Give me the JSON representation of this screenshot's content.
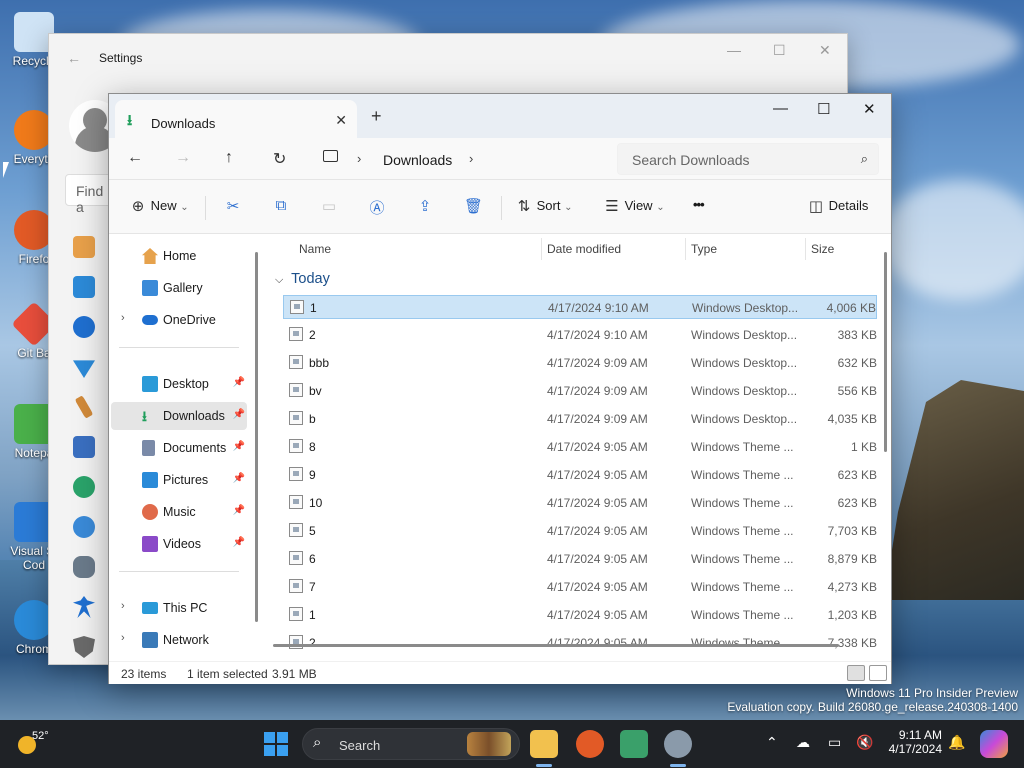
{
  "desktop": {
    "icons": [
      {
        "label": "Recycle",
        "color": "#cfe3f5"
      },
      {
        "label": "Everyth",
        "color": "#f07a1a"
      },
      {
        "label": "Firefo",
        "color": "#e25a26"
      },
      {
        "label": "Git Ba",
        "color": "#e84e3c"
      },
      {
        "label": "Notepa",
        "color": "#4ab04a"
      },
      {
        "label": "Visual St Cod",
        "color": "#2b7bd6"
      },
      {
        "label": "Chrom",
        "color": "#2a8ad8"
      }
    ],
    "watermark_line1": "Windows 11 Pro Insider Preview",
    "watermark_line2": "Evaluation copy. Build 26080.ge_release.240308-1400"
  },
  "settings": {
    "title": "Settings",
    "back_glyph": "←",
    "find_placeholder": "Find a"
  },
  "explorer": {
    "tab": {
      "label": "Downloads",
      "close_glyph": "✕",
      "new_glyph": "+"
    },
    "window_controls": {
      "minimize": "—",
      "maximize": "☐",
      "close": "✕"
    },
    "nav": {
      "back": "←",
      "forward": "→",
      "up": "↑",
      "refresh": "↻"
    },
    "breadcrumb": {
      "segment": "Downloads",
      "chevron": "›"
    },
    "search": {
      "placeholder": "Search Downloads",
      "icon": "⌕"
    },
    "commands": {
      "new": "New",
      "sort": "Sort",
      "view": "View",
      "more": "•••",
      "details": "Details",
      "caret": "⌄"
    },
    "nav_pane": {
      "home": "Home",
      "gallery": "Gallery",
      "onedrive": "OneDrive",
      "desktop": "Desktop",
      "downloads": "Downloads",
      "documents": "Documents",
      "pictures": "Pictures",
      "music": "Music",
      "videos": "Videos",
      "this_pc": "This PC",
      "network": "Network",
      "expand_glyph": "›",
      "pin_glyph": "📌"
    },
    "columns": {
      "name": "Name",
      "date": "Date modified",
      "type": "Type",
      "size": "Size"
    },
    "group": {
      "label": "Today",
      "chevron": "⌵"
    },
    "files": [
      {
        "name": "1",
        "date": "4/17/2024 9:10 AM",
        "type": "Windows Desktop...",
        "size": "4,006 KB"
      },
      {
        "name": "2",
        "date": "4/17/2024 9:10 AM",
        "type": "Windows Desktop...",
        "size": "383 KB"
      },
      {
        "name": "bbb",
        "date": "4/17/2024 9:09 AM",
        "type": "Windows Desktop...",
        "size": "632 KB"
      },
      {
        "name": "bv",
        "date": "4/17/2024 9:09 AM",
        "type": "Windows Desktop...",
        "size": "556 KB"
      },
      {
        "name": "b",
        "date": "4/17/2024 9:09 AM",
        "type": "Windows Desktop...",
        "size": "4,035 KB"
      },
      {
        "name": "8",
        "date": "4/17/2024 9:05 AM",
        "type": "Windows Theme ...",
        "size": "1 KB"
      },
      {
        "name": "9",
        "date": "4/17/2024 9:05 AM",
        "type": "Windows Theme ...",
        "size": "623 KB"
      },
      {
        "name": "10",
        "date": "4/17/2024 9:05 AM",
        "type": "Windows Theme ...",
        "size": "623 KB"
      },
      {
        "name": "5",
        "date": "4/17/2024 9:05 AM",
        "type": "Windows Theme ...",
        "size": "7,703 KB"
      },
      {
        "name": "6",
        "date": "4/17/2024 9:05 AM",
        "type": "Windows Theme ...",
        "size": "8,879 KB"
      },
      {
        "name": "7",
        "date": "4/17/2024 9:05 AM",
        "type": "Windows Theme ...",
        "size": "4,273 KB"
      },
      {
        "name": "1",
        "date": "4/17/2024 9:05 AM",
        "type": "Windows Theme ...",
        "size": "1,203 KB"
      },
      {
        "name": "2",
        "date": "4/17/2024 9:05 AM",
        "type": "Windows Theme ...",
        "size": "7,338 KB"
      }
    ],
    "status": {
      "items": "23 items",
      "selected": "1 item selected",
      "size": "3.91 MB"
    }
  },
  "taskbar": {
    "weather_temp": "52°",
    "search_label": "Search",
    "search_icon": "⌕",
    "tray_chevron": "⌃",
    "time": "9:11 AM",
    "date": "4/17/2024",
    "bell": "🔔"
  },
  "colors": {
    "accent": "#0067c0",
    "selection": "#cce4f7",
    "taskbar": "#1f2226"
  }
}
